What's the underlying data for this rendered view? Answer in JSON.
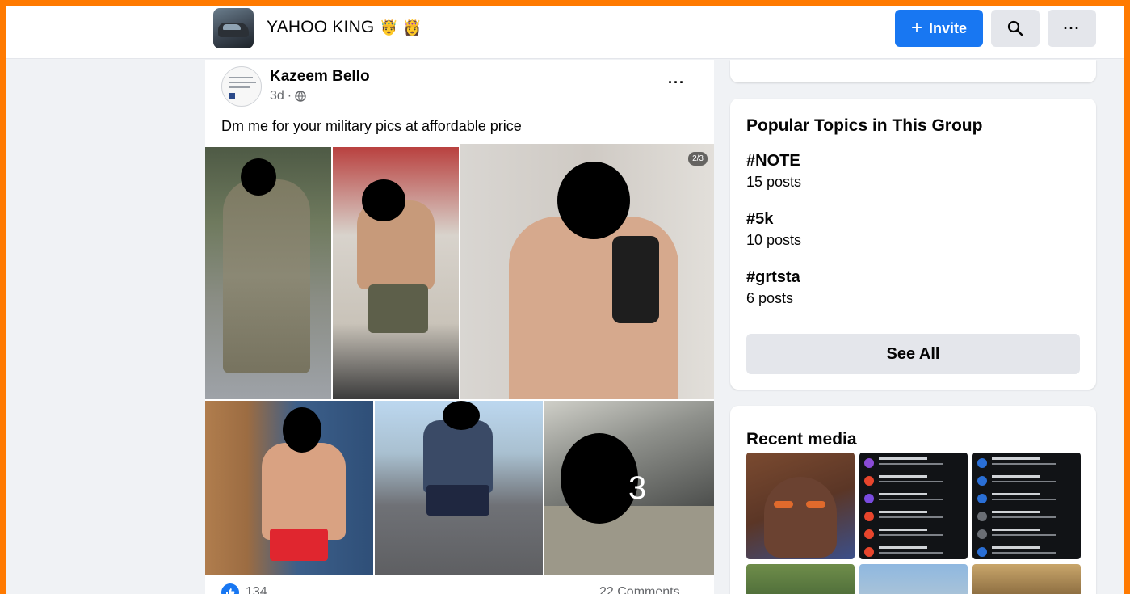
{
  "header": {
    "group_name": "YAHOO KING",
    "group_emojis": "🤴 👸",
    "invite_label": "Invite",
    "search_icon": "search-icon",
    "more_label": "···"
  },
  "post": {
    "author": "Kazeem Bello",
    "time": "3d",
    "separator": "·",
    "privacy_icon": "globe-icon",
    "more_label": "···",
    "text": "Dm me for your military pics at affordable price",
    "photo_badge": "2/3",
    "photo_overlay_digit": "3",
    "like_count": "134",
    "comments": "22 Comments"
  },
  "sidebar": {
    "topics_title": "Popular Topics in This Group",
    "topics": [
      {
        "tag": "#NOTE",
        "count": "15 posts"
      },
      {
        "tag": "#5k",
        "count": "10 posts"
      },
      {
        "tag": "#grtsta",
        "count": "6 posts"
      }
    ],
    "see_all_label": "See All",
    "media_title": "Recent media"
  },
  "colors": {
    "border_orange": "#ff7a00",
    "brand_blue": "#1877f2",
    "page_bg": "#f0f2f5",
    "button_gray": "#e4e6eb"
  }
}
